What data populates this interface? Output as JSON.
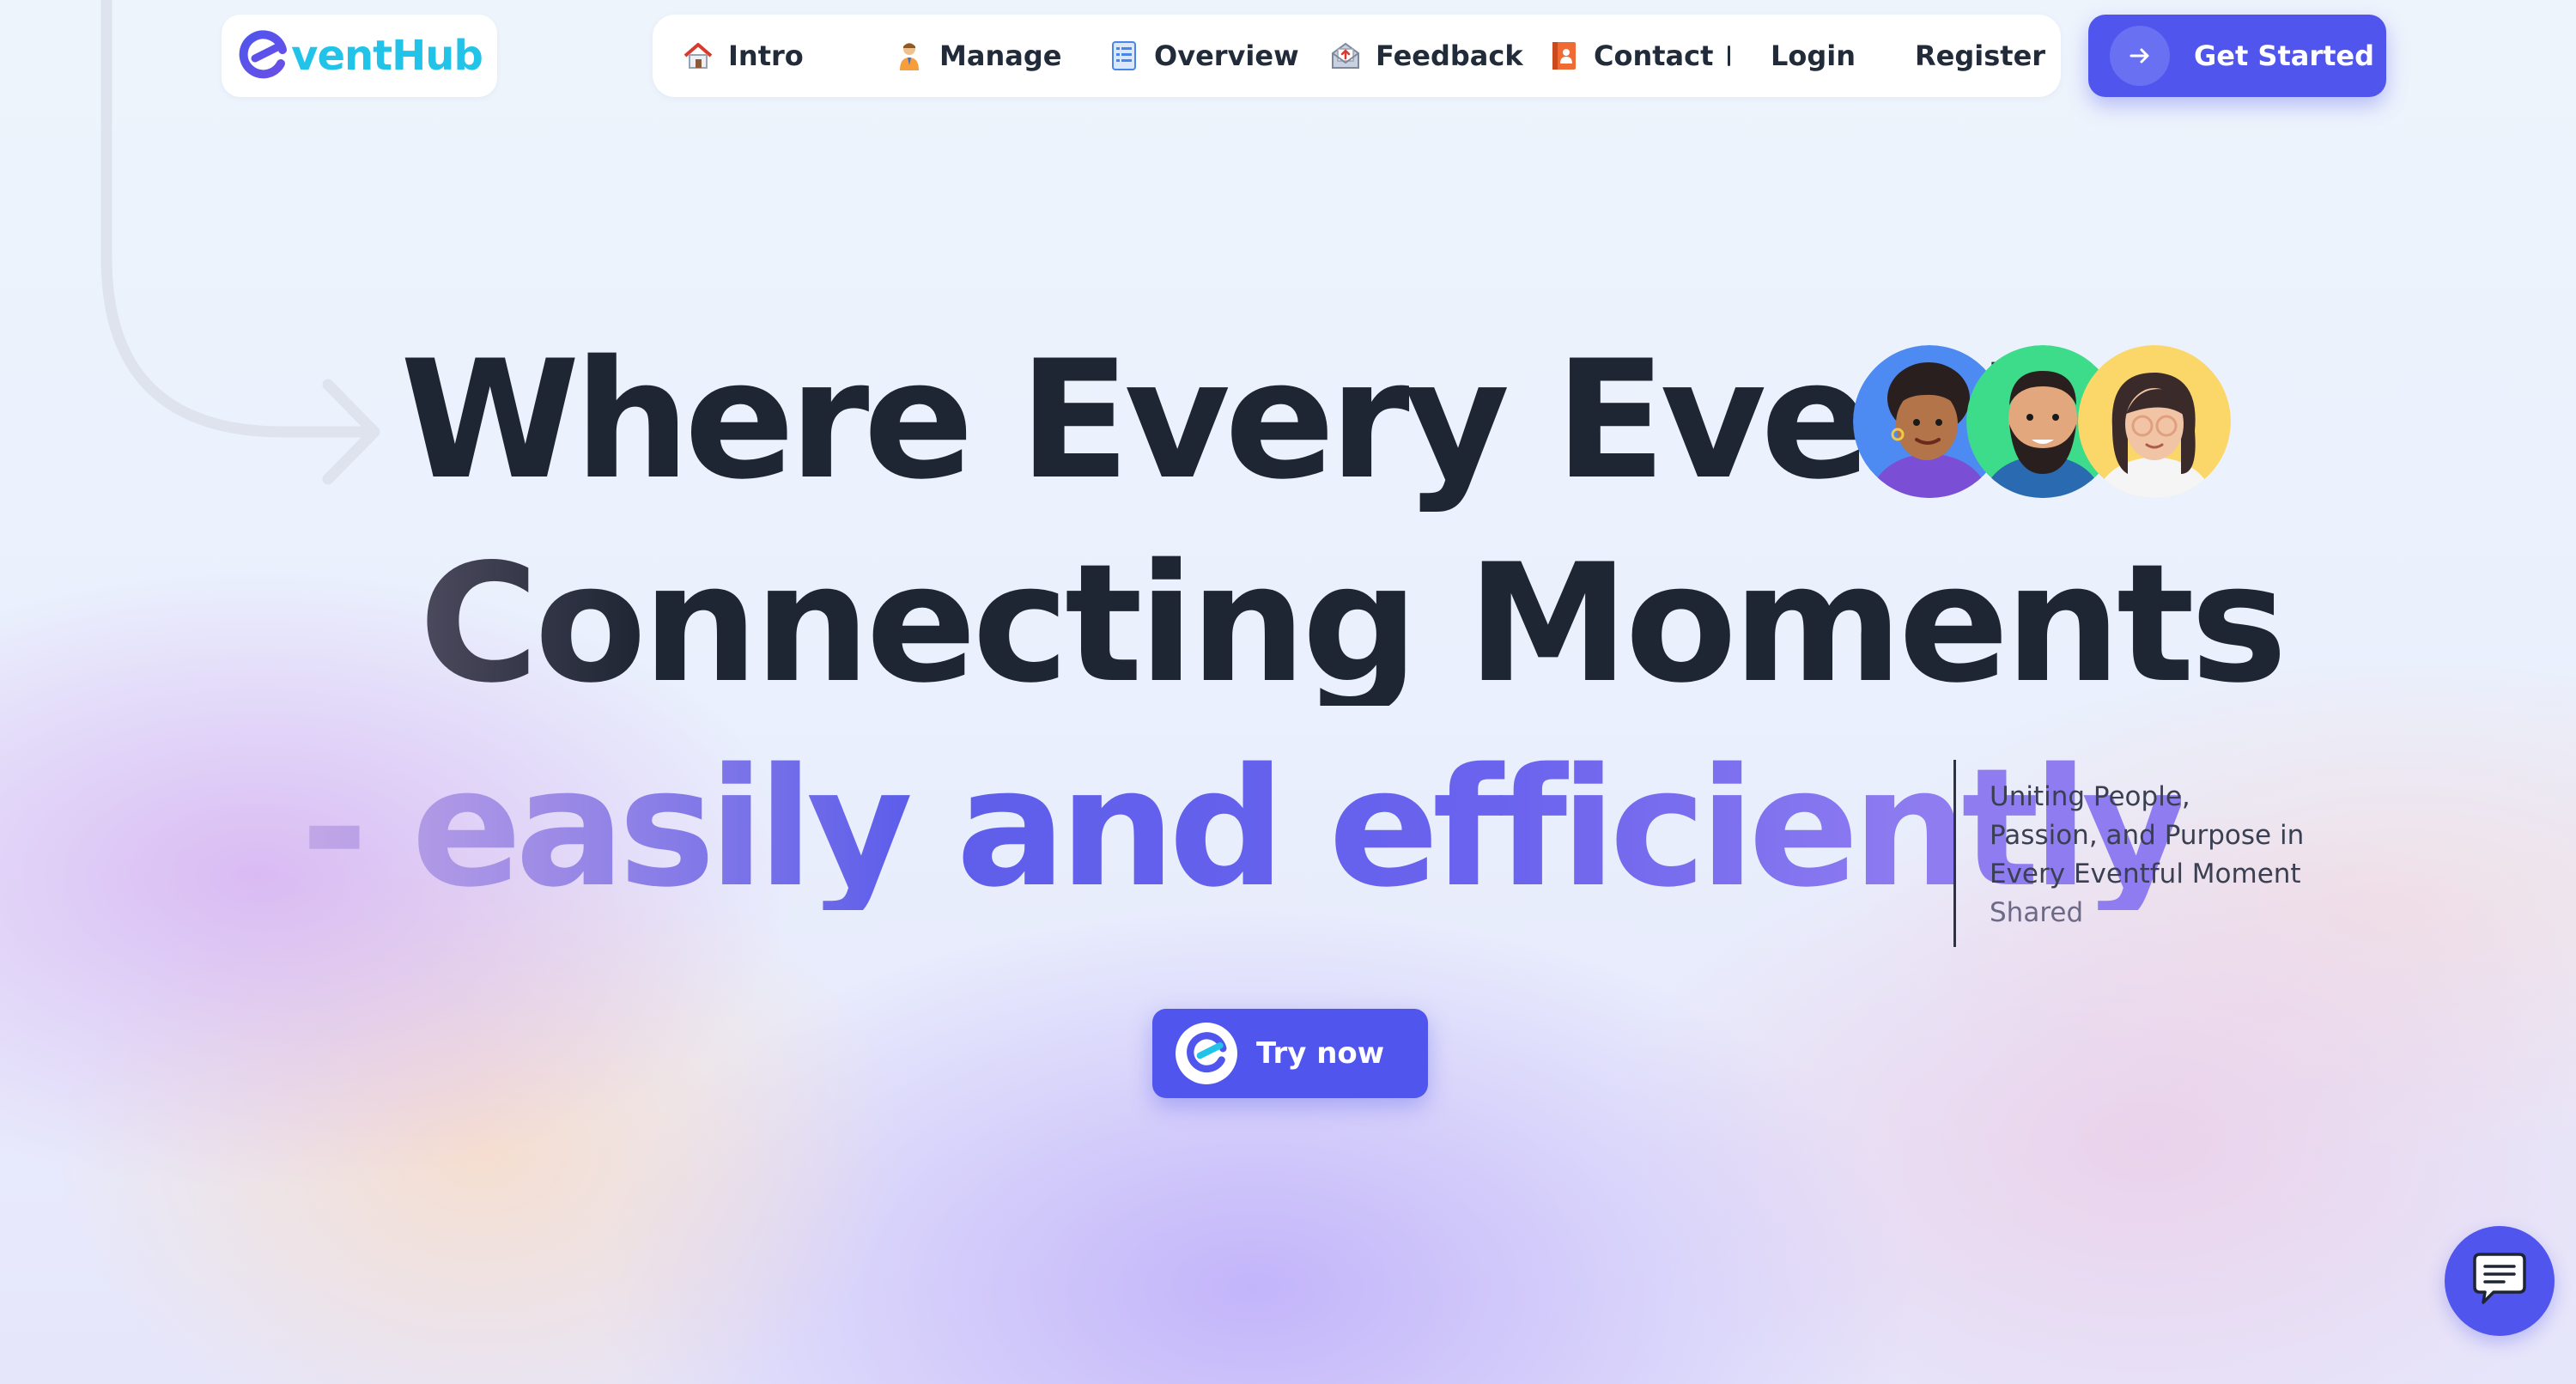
{
  "brand": {
    "logo_text": "ventHub",
    "logo_icon": "eventhub-e-logo",
    "colors": {
      "primary": "#4f55ed",
      "logo_accent": "#22c3e8",
      "heading": "#1e2533"
    }
  },
  "nav": {
    "items": [
      {
        "label": "Intro",
        "icon": "house-icon"
      },
      {
        "label": "Manage",
        "icon": "person-icon"
      },
      {
        "label": "Overview",
        "icon": "list-icon"
      },
      {
        "label": "Feedback",
        "icon": "envelope-icon"
      },
      {
        "label": "Contact",
        "icon": "contact-book-icon"
      }
    ],
    "login": "Login",
    "register": "Register"
  },
  "cta_top": {
    "label": "Get Started",
    "icon": "arrow-right-icon"
  },
  "hero": {
    "line1": "Where Every Event",
    "line2": "Connecting Moments",
    "line3": "- easily and efficiently",
    "avatars": [
      "avatar-woman-curly-hair",
      "avatar-man-beard",
      "avatar-woman-glasses"
    ],
    "tagline": {
      "l1": "Uniting People,",
      "l2": "Passion, and Purpose in",
      "l3": "Every Eventful Moment",
      "l4": "Shared"
    }
  },
  "try_button": {
    "label": "Try now",
    "icon": "eventhub-e-logo"
  },
  "chat": {
    "icon": "chat-bubble-icon"
  }
}
